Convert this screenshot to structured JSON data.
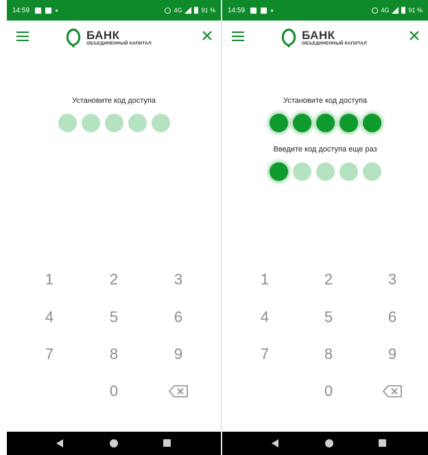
{
  "status_bar": {
    "time": "14:59",
    "signal_text": "4G",
    "battery": "91 %"
  },
  "brand": {
    "title": "БАНК",
    "subtitle": "ОБЪЕДИНЕННЫЙ КАПИТАЛ",
    "color": "#0e8a2a"
  },
  "colors": {
    "dot_empty": "#b5e2c1",
    "dot_filled": "#0e9a2d",
    "status_bar": "#0e8a2a"
  },
  "screens": [
    {
      "set_code_label": "Установите код доступа",
      "set_code_filled": 0,
      "set_code_length": 5
    },
    {
      "set_code_label": "Установите код доступа",
      "set_code_filled": 5,
      "set_code_length": 5,
      "confirm_code_label": "Введите код доступа еще раз",
      "confirm_code_filled": 1,
      "confirm_code_length": 5
    }
  ],
  "keypad": {
    "keys": [
      "1",
      "2",
      "3",
      "4",
      "5",
      "6",
      "7",
      "8",
      "9",
      "0"
    ],
    "backspace_icon": "backspace-icon"
  },
  "nav": {
    "icons": [
      "back-icon",
      "home-icon",
      "recents-icon"
    ]
  }
}
